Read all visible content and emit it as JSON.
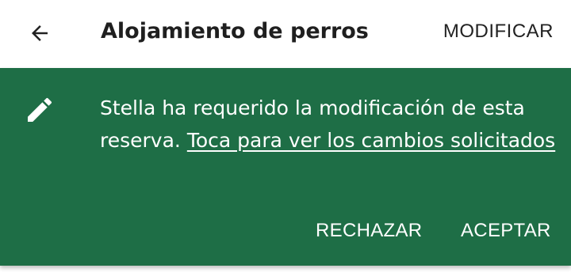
{
  "app_bar": {
    "back_icon": "arrow-back-icon",
    "title": "Alojamiento de perros",
    "modify_label": "MODIFICAR"
  },
  "banner": {
    "background_color": "#1e6e46",
    "icon": "pencil-icon",
    "message_text": "Stella ha requerido la modificación de esta reserva. ",
    "link_text": "Toca para ver los cambios solicitados",
    "reject_label": "RECHAZAR",
    "accept_label": "ACEPTAR"
  }
}
